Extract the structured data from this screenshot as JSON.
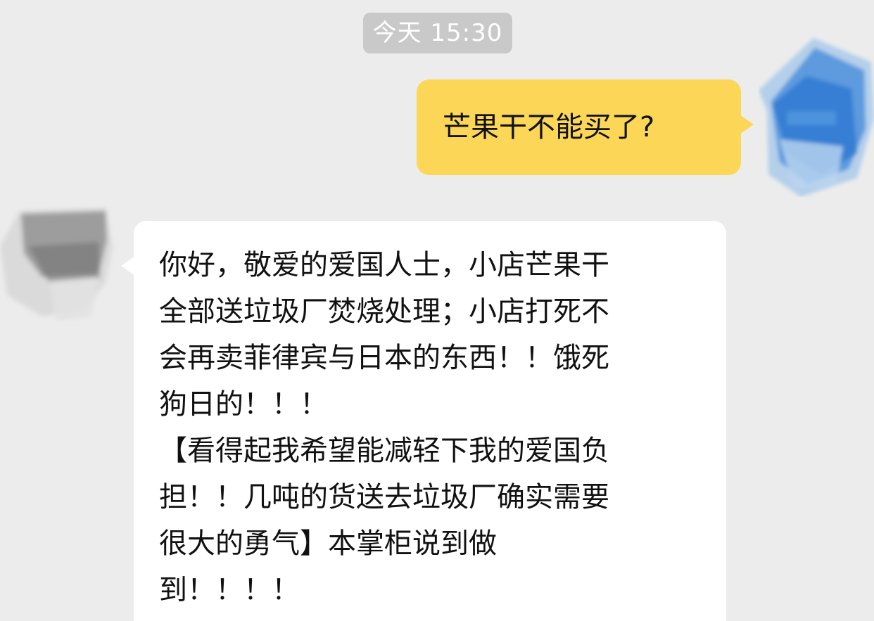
{
  "timestamp": "今天 15:30",
  "colors": {
    "background": "#ececec",
    "timestamp_bg": "#c9c9c9",
    "outgoing_bubble": "#fcd757",
    "incoming_bubble": "#ffffff"
  },
  "messages": {
    "outgoing": {
      "text": "芒果干不能买了?"
    },
    "incoming": {
      "lines": [
        "你好，敬爱的爱国人士，小店芒果干",
        "全部送垃圾厂焚烧处理；小店打死不",
        "会再卖菲律宾与日本的东西！！饿死",
        "狗日的！！！",
        "【看得起我希望能减轻下我的爱国负",
        "担！！几吨的货送去垃圾厂确实需要",
        "很大的勇气】本掌柜说到做",
        "到！！！！"
      ]
    }
  },
  "avatars": {
    "self": "blurred-blue-avatar",
    "other": "blurred-gray-avatar"
  }
}
